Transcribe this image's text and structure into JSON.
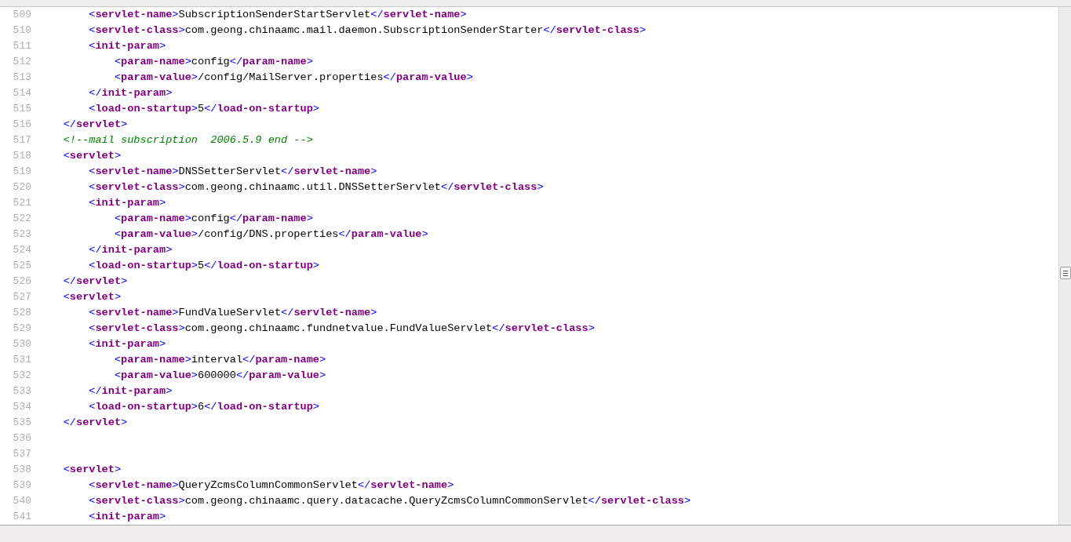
{
  "editor": {
    "lines": [
      {
        "number": "509",
        "kind": "code",
        "code": "        <servlet-name>SubscriptionSenderStartServlet</servlet-name>"
      },
      {
        "number": "510",
        "kind": "code",
        "code": "        <servlet-class>com.geong.chinaamc.mail.daemon.SubscriptionSenderStarter</servlet-class>"
      },
      {
        "number": "511",
        "kind": "code",
        "code": "        <init-param>"
      },
      {
        "number": "512",
        "kind": "code",
        "code": "            <param-name>config</param-name>"
      },
      {
        "number": "513",
        "kind": "code",
        "code": "            <param-value>/config/MailServer.properties</param-value>"
      },
      {
        "number": "514",
        "kind": "code",
        "code": "        </init-param>"
      },
      {
        "number": "515",
        "kind": "code",
        "code": "        <load-on-startup>5</load-on-startup>"
      },
      {
        "number": "516",
        "kind": "code",
        "code": "    </servlet>"
      },
      {
        "number": "517",
        "kind": "comment",
        "code": "    <!--mail subscription  2006.5.9 end -->"
      },
      {
        "number": "518",
        "kind": "code",
        "code": "    <servlet>"
      },
      {
        "number": "519",
        "kind": "code",
        "code": "        <servlet-name>DNSSetterServlet</servlet-name>"
      },
      {
        "number": "520",
        "kind": "code",
        "code": "        <servlet-class>com.geong.chinaamc.util.DNSSetterServlet</servlet-class>"
      },
      {
        "number": "521",
        "kind": "code",
        "code": "        <init-param>"
      },
      {
        "number": "522",
        "kind": "code",
        "code": "            <param-name>config</param-name>"
      },
      {
        "number": "523",
        "kind": "code",
        "code": "            <param-value>/config/DNS.properties</param-value>"
      },
      {
        "number": "524",
        "kind": "code",
        "code": "        </init-param>"
      },
      {
        "number": "525",
        "kind": "code",
        "code": "        <load-on-startup>5</load-on-startup>"
      },
      {
        "number": "526",
        "kind": "code",
        "code": "    </servlet>"
      },
      {
        "number": "527",
        "kind": "code",
        "code": "    <servlet>"
      },
      {
        "number": "528",
        "kind": "code",
        "code": "        <servlet-name>FundValueServlet</servlet-name>"
      },
      {
        "number": "529",
        "kind": "code",
        "code": "        <servlet-class>com.geong.chinaamc.fundnetvalue.FundValueServlet</servlet-class>"
      },
      {
        "number": "530",
        "kind": "code",
        "code": "        <init-param>"
      },
      {
        "number": "531",
        "kind": "code",
        "code": "            <param-name>interval</param-name>"
      },
      {
        "number": "532",
        "kind": "code",
        "code": "            <param-value>600000</param-value>"
      },
      {
        "number": "533",
        "kind": "code",
        "code": "        </init-param>"
      },
      {
        "number": "534",
        "kind": "code",
        "code": "        <load-on-startup>6</load-on-startup>"
      },
      {
        "number": "535",
        "kind": "code",
        "code": "    </servlet>"
      },
      {
        "number": "536",
        "kind": "blank"
      },
      {
        "number": "537",
        "kind": "blank"
      },
      {
        "number": "538",
        "kind": "code",
        "code": "    <servlet>"
      },
      {
        "number": "539",
        "kind": "code",
        "code": "        <servlet-name>QueryZcmsColumnCommonServlet</servlet-name>"
      },
      {
        "number": "540",
        "kind": "code",
        "code": "        <servlet-class>com.geong.chinaamc.query.datacache.QueryZcmsColumnCommonServlet</servlet-class>"
      },
      {
        "number": "541",
        "kind": "code",
        "code": "        <init-param>"
      }
    ]
  }
}
